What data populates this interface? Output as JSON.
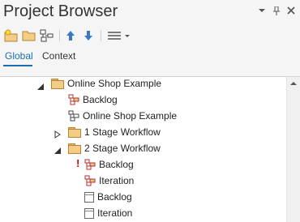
{
  "header": {
    "title": "Project Browser",
    "menu_icon": "chevron-down-icon",
    "pin_icon": "pin-icon",
    "close_icon": "close-icon"
  },
  "toolbar": {
    "buttons": [
      "new-package-icon",
      "folder-icon",
      "model-view-icon",
      "arrow-up-icon",
      "arrow-down-icon",
      "menu-icon"
    ]
  },
  "tabs": [
    {
      "label": "Global",
      "active": true
    },
    {
      "label": "Context",
      "active": false
    }
  ],
  "tree": {
    "items": [
      {
        "label": "Online Shop Example",
        "icon": "folder-icon",
        "expander": "expanded"
      },
      {
        "label": "Backlog",
        "icon": "kanban-icon"
      },
      {
        "label": "Online Shop Example",
        "icon": "model-view-icon"
      },
      {
        "label": "1 Stage Workflow",
        "icon": "folder-icon",
        "expander": "collapsed"
      },
      {
        "label": "2 Stage Workflow",
        "icon": "folder-icon",
        "expander": "expanded"
      },
      {
        "label": "Backlog",
        "icon": "kanban-icon",
        "warning": "!"
      },
      {
        "label": "Iteration",
        "icon": "kanban-icon"
      },
      {
        "label": "Backlog",
        "icon": "document-icon"
      },
      {
        "label": "Iteration",
        "icon": "document-icon"
      }
    ]
  },
  "colors": {
    "accent": "#1a6fb0",
    "folder": "#f3cd85",
    "warning": "#d40000",
    "arrow": "#3a78c3"
  }
}
